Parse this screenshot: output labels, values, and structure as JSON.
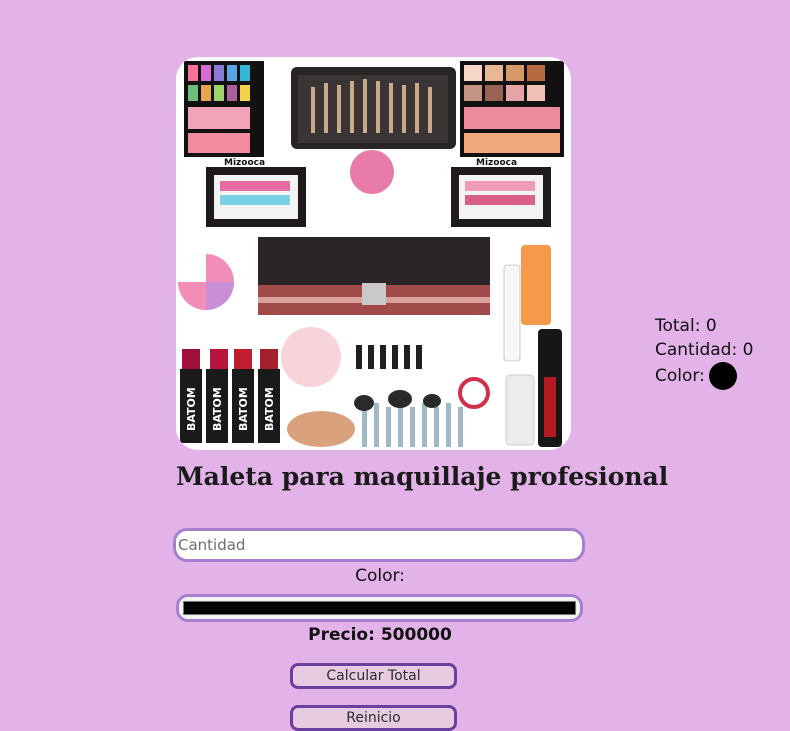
{
  "product": {
    "title": "Maleta para maquillaje profesional",
    "image_text": [
      "Mizooca",
      "Mizooca",
      "BATOM",
      "BATOM",
      "BATOM",
      "BATOM"
    ]
  },
  "form": {
    "quantity_placeholder": "Cantidad",
    "color_label": "Color:",
    "color_value": "#000000",
    "price_label": "Precio:",
    "price_value": "500000",
    "calc_button": "Calcular Total",
    "reset_button": "Reinicio"
  },
  "summary": {
    "total_label": "Total:",
    "total_value": "0",
    "quantity_label": "Cantidad:",
    "quantity_value": "0",
    "color_label": "Color:",
    "color_value": "#000000"
  },
  "colors": {
    "background": "#e2b2e8",
    "border_accent": "#a77fd0",
    "button_border": "#6a3fa0",
    "button_fill": "#e7cce1"
  }
}
